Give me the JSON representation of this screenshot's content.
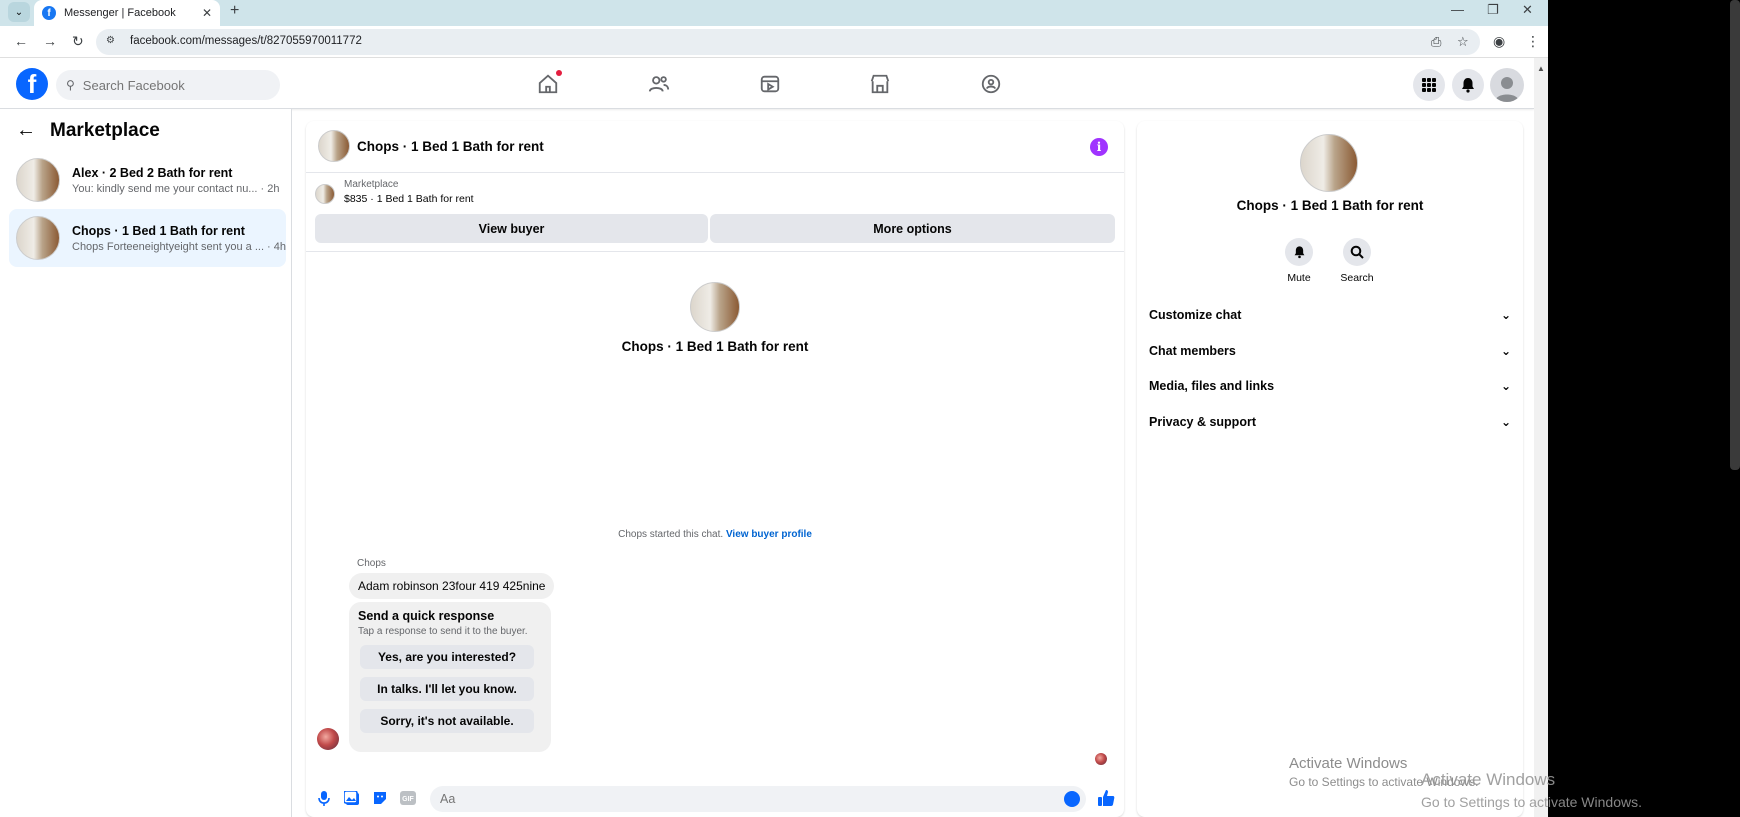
{
  "browser": {
    "tab_title": "Messenger | Facebook",
    "url": "facebook.com/messages/t/827055970011772"
  },
  "fb": {
    "search_placeholder": "Search Facebook"
  },
  "left": {
    "title": "Marketplace",
    "conversations": [
      {
        "name": "Alex · 2 Bed 2 Bath for rent",
        "preview": "You: kindly send me your contact nu... · 2h",
        "active": false
      },
      {
        "name": "Chops · 1 Bed 1 Bath for rent",
        "preview": "Chops Forteeneightyeight sent you a ... · 4h",
        "active": true
      }
    ]
  },
  "chat": {
    "title": "Chops · 1 Bed 1 Bath for rent",
    "listing_source": "Marketplace",
    "listing_price": "$835 · 1 Bed 1 Bath for rent",
    "view_buyer": "View buyer",
    "more_options": "More options",
    "intro_name": "Chops · 1 Bed 1 Bath for rent",
    "started_text": "Chops started this chat.",
    "view_buyer_profile": "View buyer profile",
    "sender": "Chops",
    "message": "Adam robinson 23four 419 425nine",
    "quick_title": "Send a quick response",
    "quick_sub": "Tap a response to send it to the buyer.",
    "quick_replies": [
      "Yes, are you interested?",
      "In talks. I'll let you know.",
      "Sorry, it's not available."
    ],
    "composer_placeholder": "Aa"
  },
  "panel": {
    "name": "Chops · 1 Bed 1 Bath for rent",
    "mute": "Mute",
    "search": "Search",
    "sections": [
      "Customize chat",
      "Chat members",
      "Media, files and links",
      "Privacy & support"
    ]
  },
  "watermark": {
    "title": "Activate Windows",
    "sub": "Go to Settings to activate Windows."
  },
  "colors": {
    "brand": "#0866ff",
    "info": "#a033ff",
    "active_bg": "#ebf5ff"
  }
}
